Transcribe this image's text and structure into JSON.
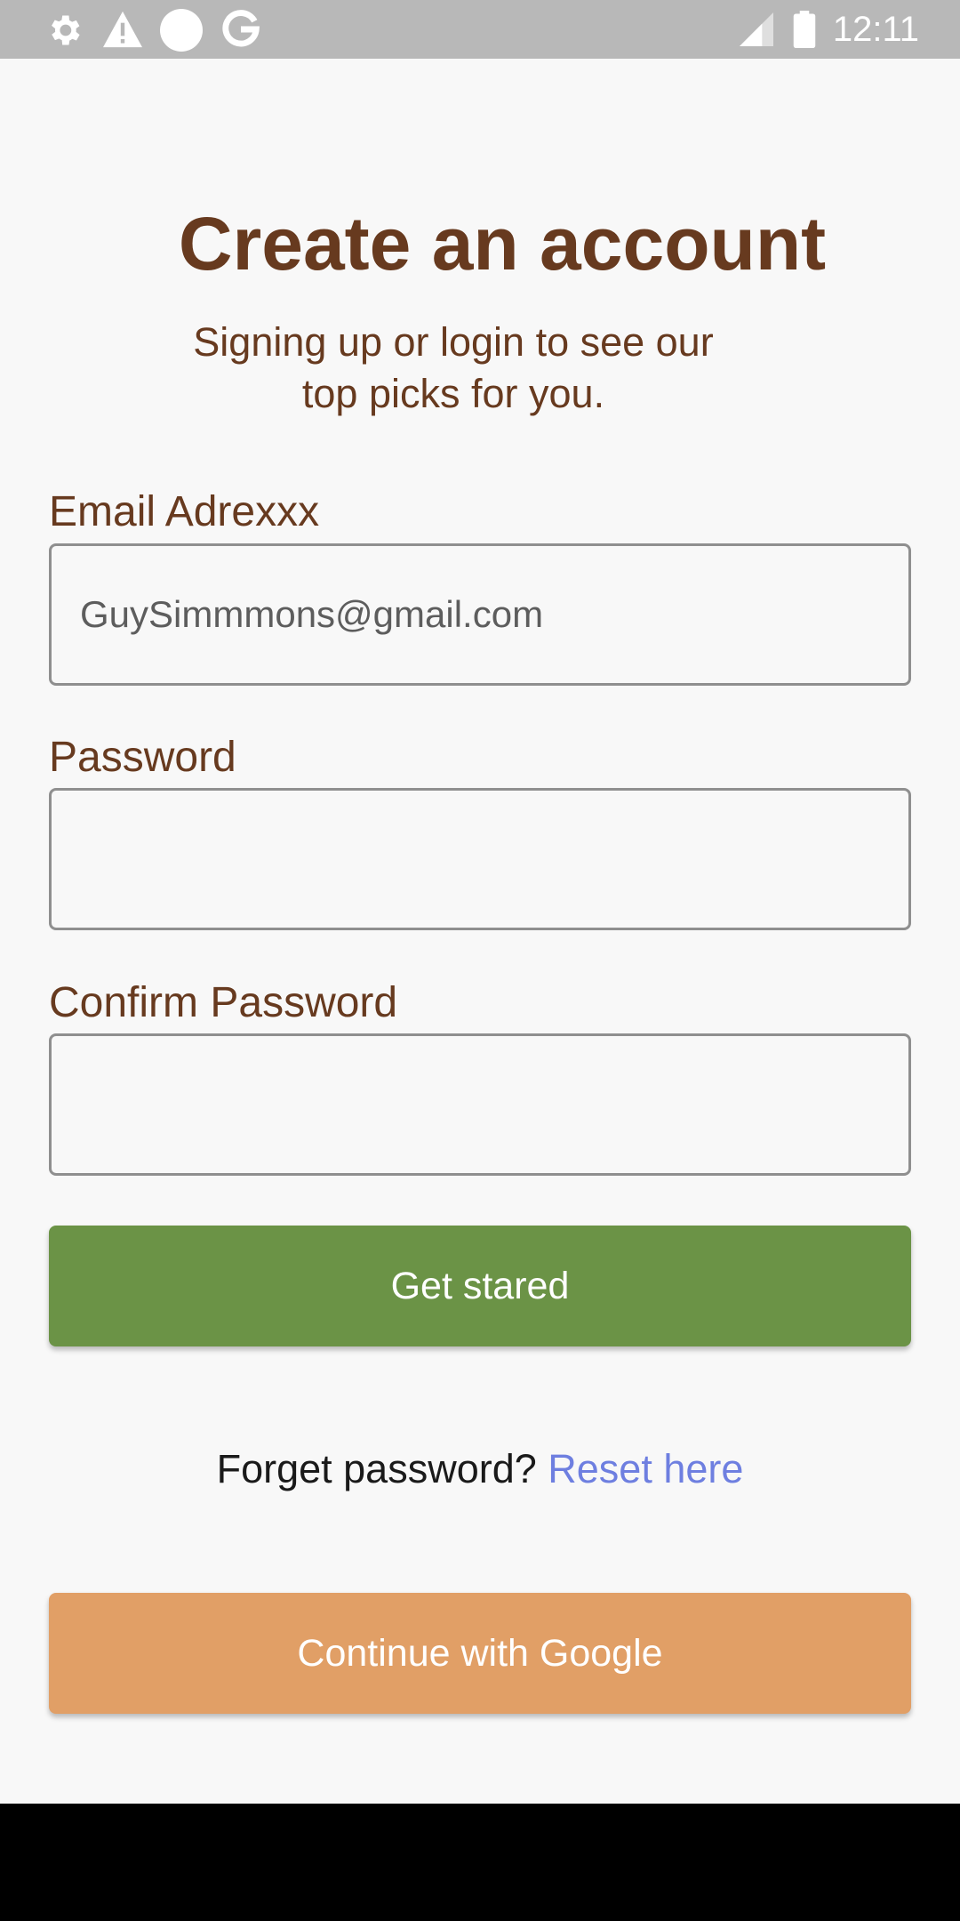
{
  "status_bar": {
    "time": "12:11",
    "left_icons": [
      "gear-icon",
      "warning-icon",
      "circle-icon",
      "google-g-icon"
    ],
    "right_icons": [
      "signal-icon",
      "battery-icon"
    ]
  },
  "header": {
    "title": "Create an account",
    "subtitle": "Signing up or login to see our top picks for you."
  },
  "form": {
    "email": {
      "label": "Email Adrexxx",
      "value": "GuySimmmons@gmail.com"
    },
    "password": {
      "label": "Password",
      "value": ""
    },
    "confirm_password": {
      "label": "Confirm Password",
      "value": ""
    }
  },
  "actions": {
    "get_started_label": "Get stared",
    "forgot_text": "Forget password?",
    "reset_link": "Reset here",
    "google_label": "Continue with Google"
  },
  "colors": {
    "accent_brown": "#673a1f",
    "primary_green": "#6b9346",
    "google_orange": "#e19f66",
    "link_blue": "#6e7fe0"
  }
}
